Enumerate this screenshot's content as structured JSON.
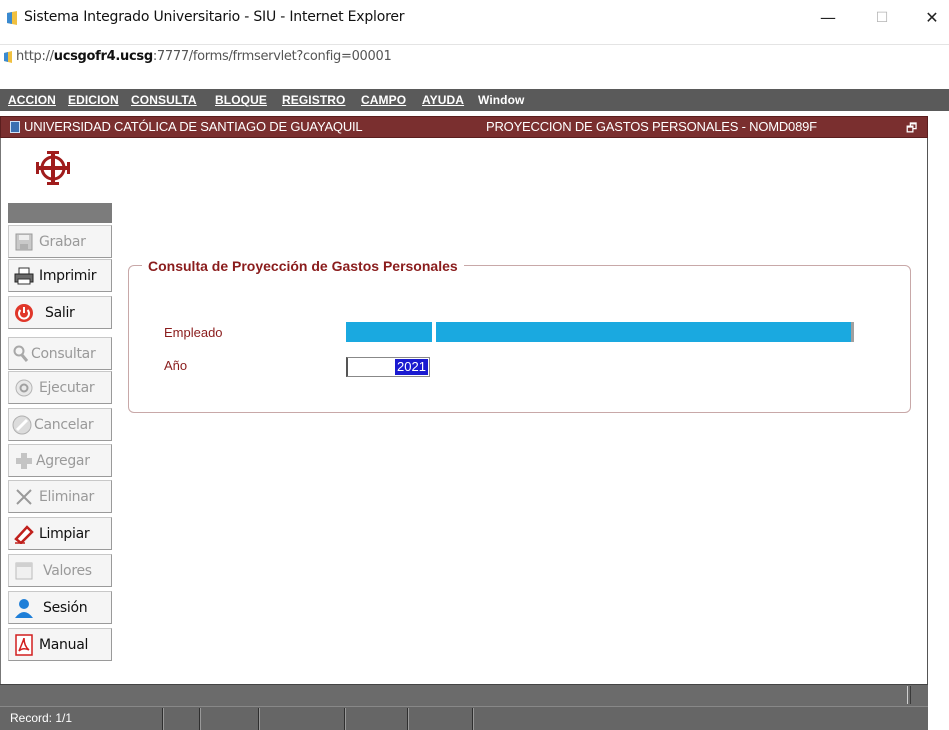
{
  "window": {
    "title": "Sistema Integrado Universitario - SIU - Internet Explorer",
    "minimize": "—",
    "maximize": "☐",
    "close": "✕"
  },
  "address": {
    "prefix": "http://",
    "host": "ucsgofr4.ucsg",
    "rest": ":7777/forms/frmservlet?config=00001"
  },
  "menu": [
    "ACCION",
    "EDICION",
    "CONSULTA",
    "BLOQUE",
    "REGISTRO",
    "CAMPO",
    "AYUDA",
    "Window"
  ],
  "form": {
    "left_title": "UNIVERSIDAD CATÓLICA DE SANTIAGO DE GUAYAQUIL",
    "right_title": "PROYECCION DE GASTOS PERSONALES - NOMD089F",
    "restore_glyph": "🗗"
  },
  "sidebar": [
    {
      "label": "Grabar",
      "icon": "save-icon",
      "enabled": false
    },
    {
      "label": "Imprimir",
      "icon": "printer-icon",
      "enabled": true
    },
    {
      "label": "Salir",
      "icon": "power-icon",
      "enabled": true
    },
    {
      "label": "Consultar",
      "icon": "search-icon",
      "enabled": false
    },
    {
      "label": "Ejecutar",
      "icon": "execute-icon",
      "enabled": false
    },
    {
      "label": "Cancelar",
      "icon": "cancel-icon",
      "enabled": false
    },
    {
      "label": "Agregar",
      "icon": "add-icon",
      "enabled": false
    },
    {
      "label": "Eliminar",
      "icon": "delete-icon",
      "enabled": false
    },
    {
      "label": "Limpiar",
      "icon": "eraser-icon",
      "enabled": true
    },
    {
      "label": "Valores",
      "icon": "values-icon",
      "enabled": false
    },
    {
      "label": "Sesión",
      "icon": "user-icon",
      "enabled": true
    },
    {
      "label": "Manual",
      "icon": "pdf-icon",
      "enabled": true
    }
  ],
  "consulta": {
    "legend": "Consulta de Proyección de Gastos Personales",
    "empleado_label": "Empleado",
    "anio_label": "Año",
    "anio_value": "2021"
  },
  "status": {
    "record": "Record: 1/1"
  },
  "colors": {
    "title_bar": "#7a2f2f",
    "menu_bar": "#5a5a5a",
    "label": "#8a1c1c",
    "field_highlight": "#1aa9e0",
    "selection": "#1a1ad0"
  }
}
